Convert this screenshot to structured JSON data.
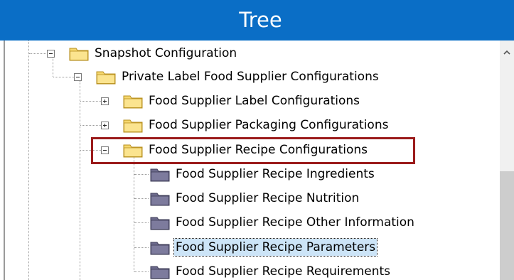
{
  "header": {
    "title": "Tree"
  },
  "tree": {
    "items": [
      {
        "label": "Snapshot Configuration",
        "type": "folder",
        "state": "expanded"
      },
      {
        "label": "Private Label Food Supplier Configurations",
        "type": "folder",
        "state": "expanded"
      },
      {
        "label": "Food Supplier Label Configurations",
        "type": "folder",
        "state": "collapsed"
      },
      {
        "label": "Food Supplier Packaging Configurations",
        "type": "folder",
        "state": "collapsed"
      },
      {
        "label": "Food Supplier Recipe Configurations",
        "type": "folder",
        "state": "expanded"
      },
      {
        "label": "Food Supplier Recipe Ingredients",
        "type": "leaf-folder"
      },
      {
        "label": "Food Supplier Recipe Nutrition",
        "type": "leaf-folder"
      },
      {
        "label": "Food Supplier Recipe Other Information",
        "type": "leaf-folder"
      },
      {
        "label": "Food Supplier Recipe Parameters",
        "type": "leaf-folder",
        "selected": true
      },
      {
        "label": "Food Supplier Recipe Requirements",
        "type": "leaf-folder"
      }
    ]
  },
  "colors": {
    "header_bg": "#0a6ec6",
    "highlight_border": "#9b1b1b",
    "selection_bg": "#cce4f7",
    "folder_yellow": "#f5d76e",
    "leaf_folder_purple": "#6c6a8c"
  },
  "icons": {
    "folder": "folder-icon",
    "leaf": "dark-folder-icon",
    "scroll_up": "chevron-up-icon"
  }
}
